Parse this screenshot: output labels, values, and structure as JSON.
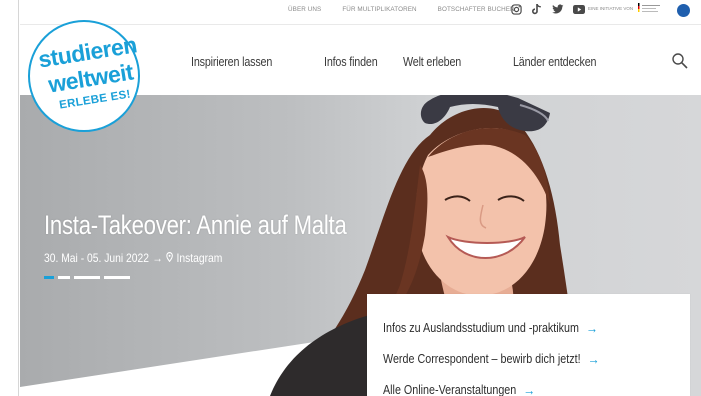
{
  "topbar": {
    "links": [
      "ÜBER UNS",
      "FÜR MULTIPLIKATOREN",
      "BOTSCHAFTER BUCHEN"
    ],
    "social_icons": [
      "instagram-icon",
      "tiktok-icon",
      "twitter-icon",
      "youtube-icon"
    ],
    "initiative_label": "EINE INITIATIVE VON"
  },
  "logo": {
    "line1": "studieren",
    "line2": "weltweit",
    "line3": "ERLEBE ES!"
  },
  "nav": {
    "items": [
      "Inspirieren lassen",
      "Infos finden",
      "Welt erleben",
      "Länder entdecken"
    ]
  },
  "hero": {
    "title": "Insta-Takeover: Annie auf Malta",
    "date": "30. Mai - 05. Juni 2022",
    "location": "Instagram",
    "slides": 4,
    "active_slide": 1
  },
  "infobox": {
    "links": [
      "Infos zu Auslandsstudium und -praktikum",
      "Werde Correspondent – bewirb dich jetzt!",
      "Alle Online-Veranstaltungen"
    ]
  },
  "colors": {
    "accent": "#1aa0d8",
    "text": "#3b3b3b",
    "daad_blue": "#1f5fae"
  }
}
